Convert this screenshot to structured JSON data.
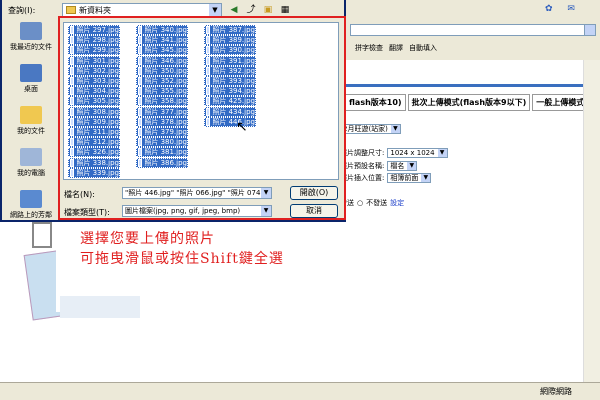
{
  "dialog": {
    "lookin_label": "查詢(I):",
    "lookin_value": "新資料夾",
    "places": [
      "我最近的文件",
      "桌面",
      "我的文件",
      "我的電腦",
      "網路上的芳鄰"
    ],
    "files_col1": [
      "照片 297.jpg",
      "照片 298.jpg",
      "照片 299.jpg",
      "照片 301.jpg",
      "照片 302.jpg",
      "照片 303.jpg",
      "照片 304.jpg",
      "照片 305.jpg",
      "照片 308.jpg",
      "照片 309.jpg",
      "照片 311.jpg",
      "照片 312.jpg",
      "照片 326.jpg",
      "照片 338.jpg",
      "照片 339.jpg"
    ],
    "files_col2": [
      "照片 340.jpg",
      "照片 341.jpg",
      "照片 345.jpg",
      "照片 346.jpg",
      "照片 350.jpg",
      "照片 352.jpg",
      "照片 355.jpg",
      "照片 358.jpg",
      "照片 377.jpg",
      "照片 378.jpg",
      "照片 379.jpg",
      "照片 380.jpg",
      "照片 381.jpg",
      "照片 386.jpg"
    ],
    "files_col3": [
      "照片 387.jpg",
      "照片 389.jpg",
      "照片 390.jpg",
      "照片 391.jpg",
      "照片 392.jpg",
      "照片 393.jpg",
      "照片 394.jpg",
      "照片 425.jpg",
      "照片 434.jpg",
      "照片 446.jpg"
    ],
    "filename_label": "檔名(N):",
    "filename_value": "\"照片 446.jpg\" \"照片 066.jpg\" \"照片 074.jpg\"",
    "filetype_label": "檔案類型(T):",
    "filetype_value": "圖片檔案(jpg, png, gif, jpeg, bmp)",
    "open_button": "開啟(O)",
    "cancel_button": "取消"
  },
  "annotation": {
    "line1": "選擇您要上傳的照片",
    "line2": "可拖曳滑鼠或按住Shift鍵全選"
  },
  "browser": {
    "toolbar": [
      "拼字檢查",
      "翻譯",
      "自動填入"
    ],
    "tabs": [
      "flash版本10)",
      "批次上傳模式(flash版本9以下)",
      "一般上傳模式"
    ],
    "album_select": "2月旺遊(站家)",
    "resize_label": "照片調整尺寸:",
    "resize_value": "1024 x 1024",
    "naming_label": "照片預設名稱:",
    "naming_value": "檔名",
    "insert_label": "照片插入位置:",
    "insert_value": "相簿前面",
    "radio1": "發送",
    "radio2": "不發送",
    "settings_link": "設定",
    "status_zone": "網際網路"
  },
  "colors": {
    "accent": "#316ac5",
    "annotation": "#e02020",
    "dialog_bg": "#ece9d8"
  }
}
